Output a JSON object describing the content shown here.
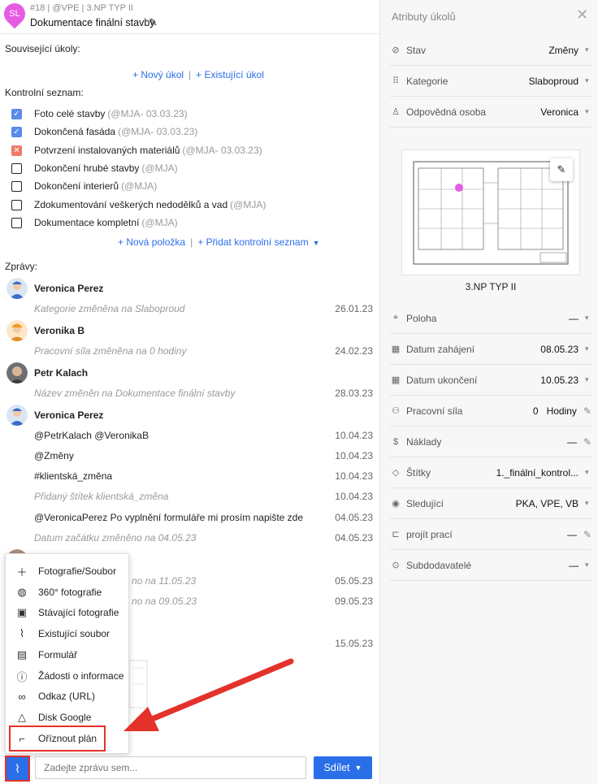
{
  "task": {
    "meta": "#18 | @VPE | 3.NP TYP II",
    "title": "Dokumentace finální stavby",
    "avatar_initials": "SL",
    "avatar_color": "#e65be3"
  },
  "related": {
    "label": "Související úkoly:",
    "new_task": "+ Nový úkol",
    "existing_task": "+ Existující úkol"
  },
  "checklist": {
    "label": "Kontrolní seznam:",
    "items": [
      {
        "text": "Foto celé stavby",
        "meta": "(@MJA- 03.03.23)",
        "state": "checked"
      },
      {
        "text": "Dokončená fasáda",
        "meta": "(@MJA- 03.03.23)",
        "state": "checked"
      },
      {
        "text": "Potvrzení instalovaných materiálů",
        "meta": "(@MJA- 03.03.23)",
        "state": "failed"
      },
      {
        "text": "Dokončení hrubé stavby",
        "meta": "(@MJA)",
        "state": "unchecked"
      },
      {
        "text": "Dokončení interierů",
        "meta": "(@MJA)",
        "state": "unchecked"
      },
      {
        "text": "Zdokumentování veškerých nedodělků a vad",
        "meta": "(@MJA)",
        "state": "unchecked"
      },
      {
        "text": "Dokumentace kompletní",
        "meta": "(@MJA)",
        "state": "unchecked"
      }
    ],
    "add_item": "+ Nová položka",
    "add_list": "+ Přidat kontrolní seznam"
  },
  "messages": {
    "label": "Zprávy:",
    "authors": [
      "Veronica Perez",
      "Veronika B",
      "Petr Kalach",
      "Veronica Perez"
    ],
    "lines": [
      {
        "text": "Kategorie změněna na Slaboproud",
        "date": "26.01.23",
        "system": true
      },
      {
        "text": "Pracovní síla změněna na 0 hodiny",
        "date": "24.02.23",
        "system": true
      },
      {
        "text": "Název změněn na Dokumentace finální stavby",
        "date": "28.03.23",
        "system": true
      },
      {
        "text": "@PetrKalach @VeronikaB",
        "date": "10.04.23",
        "system": false
      },
      {
        "text": "@Změny",
        "date": "10.04.23",
        "system": false
      },
      {
        "text": "#klientská_změna",
        "date": "10.04.23",
        "system": false
      },
      {
        "text": "Přidaný štítek klientská_změna",
        "date": "10.04.23",
        "system": true
      },
      {
        "text": "@VeronicaPerez Po vyplnění formuláře mi prosím napište zde",
        "date": "04.05.23",
        "system": false
      },
      {
        "text": "Datum začátku změněno na 04.05.23",
        "date": "04.05.23",
        "system": true
      },
      {
        "text": "no na 11.05.23",
        "date": "05.05.23",
        "system": true
      },
      {
        "text": "no na 09.05.23",
        "date": "09.05.23",
        "system": true
      },
      {
        "text": "",
        "date": "15.05.23",
        "system": false
      }
    ]
  },
  "attach_menu": {
    "items": [
      {
        "label": "Fotografie/Soubor",
        "icon": "plus-icon"
      },
      {
        "label": "360° fotografie",
        "icon": "globe-icon"
      },
      {
        "label": "Stávající fotografie",
        "icon": "camera-icon"
      },
      {
        "label": "Existující soubor",
        "icon": "paperclip-icon"
      },
      {
        "label": "Formulář",
        "icon": "clipboard-icon"
      },
      {
        "label": "Žádosti o informace",
        "icon": "info-doc-icon"
      },
      {
        "label": "Odkaz (URL)",
        "icon": "link-icon"
      },
      {
        "label": "Disk Google",
        "icon": "drive-icon"
      },
      {
        "label": "Oříznout plán",
        "icon": "crop-plan-icon"
      }
    ]
  },
  "composer": {
    "placeholder": "Zadejte zprávu sem...",
    "share": "Sdílet"
  },
  "attributes": {
    "title": "Atributy úkolů",
    "rows_top": [
      {
        "label": "Stav",
        "value": "Změny",
        "icon": "status-icon",
        "control": "chevron"
      },
      {
        "label": "Kategorie",
        "value": "Slaboproud",
        "icon": "grid-icon",
        "control": "chevron"
      },
      {
        "label": "Odpovědná osoba",
        "value": "Veronica",
        "icon": "person-icon",
        "control": "chevron"
      }
    ],
    "plan_caption": "3.NP TYP II",
    "rows_bottom": [
      {
        "label": "Poloha",
        "value": "—",
        "icon": "location-icon",
        "control": "chevron"
      },
      {
        "label": "Datum zahájení",
        "value": "08.05.23",
        "icon": "calendar-icon",
        "control": "chevron"
      },
      {
        "label": "Datum ukončení",
        "value": "10.05.23",
        "icon": "calendar-icon",
        "control": "chevron"
      },
      {
        "label": "Pracovní síla",
        "value": "0   Hodiny",
        "icon": "people-icon",
        "control": "pencil"
      },
      {
        "label": "Náklady",
        "value": "—",
        "icon": "money-icon",
        "control": "pencil"
      },
      {
        "label": "Štítky",
        "value": "1._finální_kontrol...",
        "icon": "tag-icon",
        "control": "chevron"
      },
      {
        "label": "Sledující",
        "value": "PKA, VPE, VB",
        "icon": "eye-icon",
        "control": "chevron"
      },
      {
        "label": "projít prací",
        "value": "—",
        "icon": "walk-icon",
        "control": "pencil"
      },
      {
        "label": "Subdodavatelé",
        "value": "—",
        "icon": "subcontractor-icon",
        "control": "chevron"
      }
    ]
  },
  "colors": {
    "accent": "#2a6ee8",
    "highlight": "#e4312b",
    "check": "#5b8be8",
    "fail": "#f07a6a"
  }
}
